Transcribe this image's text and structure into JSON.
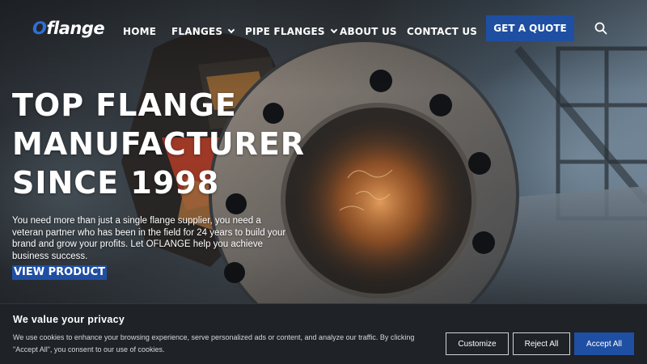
{
  "header": {
    "logo": {
      "mark": "O",
      "rest": "flange"
    },
    "nav": [
      {
        "label": "HOME",
        "has_dropdown": false
      },
      {
        "label": "FLANGES",
        "has_dropdown": true
      },
      {
        "label": "PIPE FLANGES",
        "has_dropdown": true
      },
      {
        "label": "ABOUT US",
        "has_dropdown": false
      },
      {
        "label": "CONTACT US",
        "has_dropdown": false
      }
    ],
    "cta_label": "GET A QUOTE",
    "search_icon": "search-icon"
  },
  "hero": {
    "title_lines": [
      "TOP FLANGE",
      "MANUFACTURER",
      "SINCE 1998"
    ],
    "description": "You need more than just a single flange supplier, you need a veteran partner who has been in the field for 24 years to build your brand and grow your profits. Let OFLANGE help you achieve business success.",
    "button_label": "VIEW PRODUCT"
  },
  "cookie_banner": {
    "title": "We value your privacy",
    "text": "We use cookies to enhance your browsing experience, serve personalized ads or content, and analyze our traffic. By clicking \"Accept All\", you consent to our use of cookies.",
    "buttons": {
      "customize": "Customize",
      "reject": "Reject All",
      "accept": "Accept All"
    }
  },
  "colors": {
    "brand_blue": "#1f4fa3",
    "logo_accent": "#2f6fd6",
    "banner_bg": "#1f2227"
  }
}
